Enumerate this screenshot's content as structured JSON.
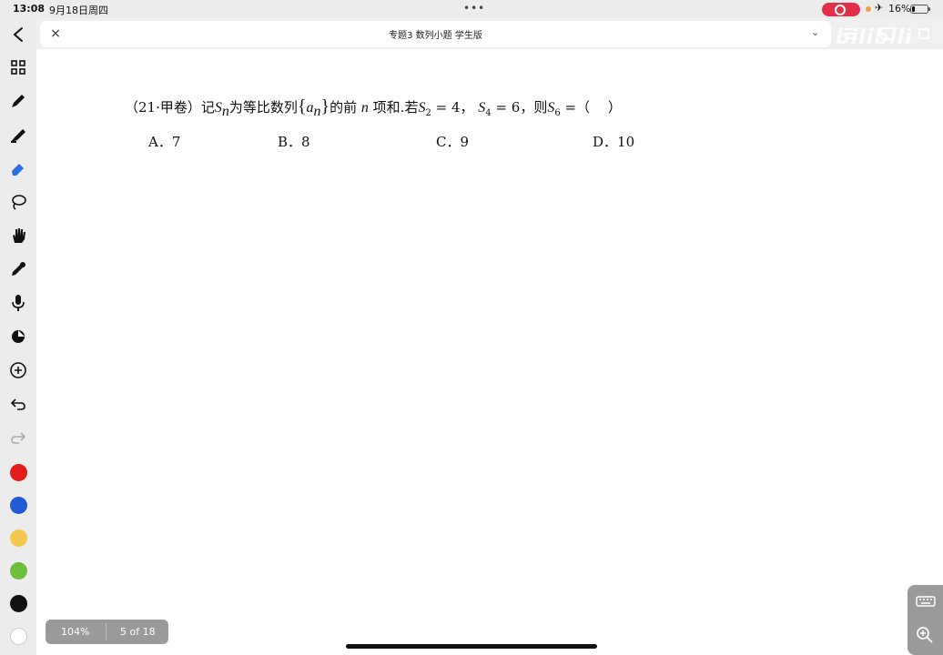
{
  "status": {
    "time": "13:08",
    "date": "9月18日周四",
    "dots": "•••",
    "battery": "16%"
  },
  "titlebar": {
    "title": "专题3 数列小题 学生版",
    "close_icon": "×",
    "chevron": "⌄"
  },
  "watermark": "bilibili",
  "question": {
    "source": "（21·甲卷）记",
    "S": "S",
    "n": "n",
    "mid1": "为等比数列",
    "lbrace": "{",
    "a": "a",
    "rbrace": "}",
    "mid2": "的前",
    "mid3": "项和.若",
    "s2": "2",
    "eq1": "= 4，",
    "s4": "4",
    "eq2": "= 6，则",
    "s6": "6",
    "eq3": "=（　 ）"
  },
  "options": [
    {
      "label": "A．7"
    },
    {
      "label": "B．8"
    },
    {
      "label": "C．9"
    },
    {
      "label": "D．10"
    }
  ],
  "page_indicator": {
    "zoom": "104%",
    "pages": "5 of 18"
  },
  "colors": {
    "palette": [
      "#e31b1b",
      "#1f5bd6",
      "#f2c94c",
      "#6cbf3c",
      "#111111",
      "#ffffff"
    ],
    "record": "#e2304b"
  },
  "icons": [
    "back-icon",
    "thumbnails-icon",
    "pen-icon",
    "highlighter-icon",
    "eraser-icon",
    "lasso-icon",
    "hand-icon",
    "eyedropper-icon",
    "microphone-icon",
    "sticker-icon",
    "add-icon",
    "undo-icon",
    "redo-icon",
    "keyboard-icon",
    "zoom-icon"
  ]
}
